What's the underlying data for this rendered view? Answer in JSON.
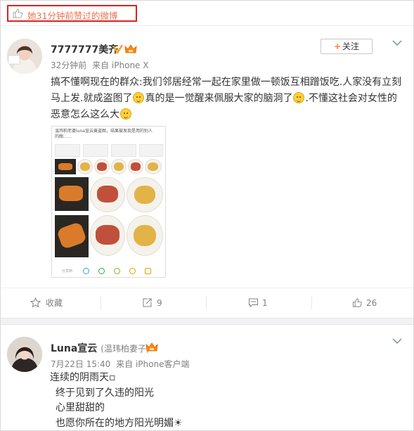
{
  "liked_header": {
    "text": "她31分钟前赞过的微博"
  },
  "post1": {
    "username": "7777777美齐",
    "time": "32分钟前",
    "source": "来自 iPhone X",
    "follow_label": "关注",
    "text_part1": "搞不懂啊现在的群众:我们邻居经常一起在家里做一顿饭互相蹭饭吃.人家没有立刻马上发.就成盗图了",
    "text_part2": "真的是一觉醒来佩服大家的脑洞了",
    "text_part3": ".不懂这社会对女性的恶意怎么这么大",
    "image_caption_a": "温玮柏老婆luna宣云竟盗图，结果被发现是用的别人",
    "image_caption_b": "的图......",
    "image_footer": "分享到",
    "actions": {
      "favorite": "收藏",
      "repost": "9",
      "comment": "1",
      "like": "26"
    }
  },
  "post2": {
    "username": "Luna宣云",
    "remark": "(温玮柏妻子)",
    "time": "7月22日 15:40",
    "source": "来自 iPhone客户端",
    "lines": [
      "连续的阴雨天▫",
      "终于见到了久违的阳光",
      "心里甜甜的",
      "也愿你所在的地方阳光明媚☀"
    ]
  },
  "colors": {
    "accent_orange": "#eb7350",
    "highlight_red": "#e02020",
    "muted_text": "#808080",
    "verified_gold": "#f5a623"
  },
  "icons": [
    "thumbs-up-icon",
    "verified-badge-icon",
    "vip-badge-icon",
    "chevron-down-icon",
    "star-icon",
    "repost-icon",
    "comment-icon",
    "like-icon"
  ]
}
